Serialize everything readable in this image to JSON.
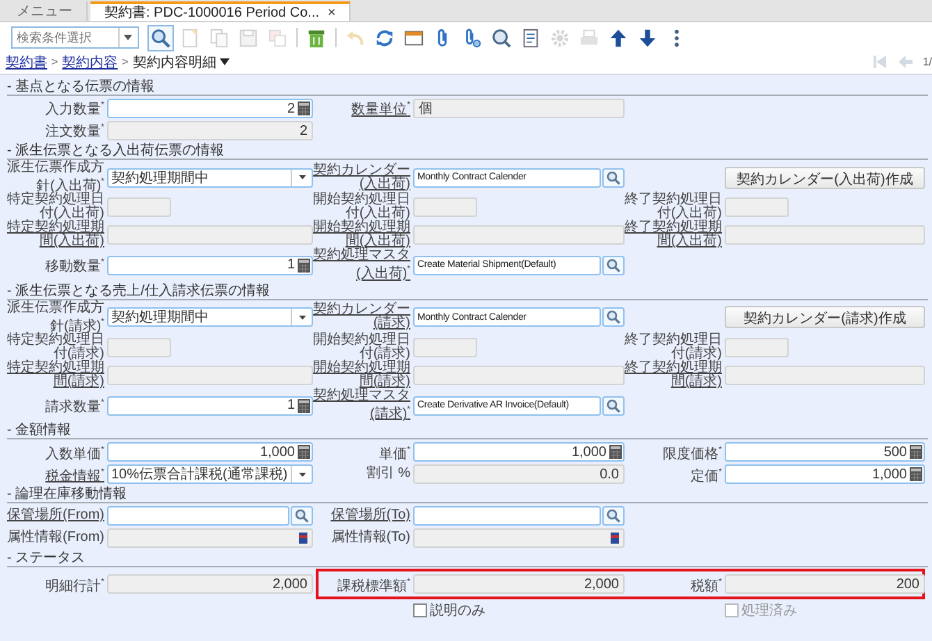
{
  "tabs": [
    {
      "label": "メニュー",
      "selected": false
    },
    {
      "label": "契約書: PDC-1000016 Period Co...",
      "selected": true,
      "close": "×"
    }
  ],
  "search": {
    "placeholder": "検索条件選択"
  },
  "toolbar": [
    {
      "kind": "search",
      "disabled": false
    },
    {
      "kind": "document",
      "disabled": true
    },
    {
      "kind": "copy",
      "disabled": true
    },
    {
      "kind": "save",
      "disabled": true
    },
    {
      "kind": "duplicate",
      "disabled": true
    },
    {
      "kind": "separator"
    },
    {
      "kind": "trash",
      "disabled": false
    },
    {
      "kind": "separator"
    },
    {
      "kind": "undo",
      "disabled": true
    },
    {
      "kind": "refresh",
      "disabled": false
    },
    {
      "kind": "window",
      "disabled": false
    },
    {
      "kind": "paperclip",
      "disabled": false
    },
    {
      "kind": "paperclip-search",
      "disabled": false
    },
    {
      "kind": "zoom",
      "disabled": false
    },
    {
      "kind": "report",
      "disabled": false
    },
    {
      "kind": "gear",
      "disabled": true
    },
    {
      "kind": "printer",
      "disabled": true
    },
    {
      "kind": "arrow-up",
      "disabled": false
    },
    {
      "kind": "arrow-down",
      "disabled": false
    },
    {
      "kind": "more",
      "disabled": false
    }
  ],
  "breadcrumb": {
    "separator": ">",
    "items": [
      {
        "label": "契約書",
        "link": true
      },
      {
        "label": "契約内容",
        "link": true
      },
      {
        "label": "契約内容明細",
        "link": false,
        "menu": true
      }
    ]
  },
  "record_nav": {
    "buttons": [
      {
        "kind": "first",
        "disabled": true
      },
      {
        "kind": "previous",
        "disabled": true
      }
    ],
    "position": "1/"
  },
  "sections": [
    {
      "title": "- 基点となる伝票の情報",
      "rows": [
        {
          "cells": [
            {
              "label": "入力数量$^{*}$",
              "link": false,
              "kind": "number",
              "value": "2"
            },
            {
              "label": "数量単位$^{*}$",
              "link": true,
              "kind": "text",
              "value": "個"
            },
            null
          ]
        },
        {
          "cells": [
            {
              "label": "注文数量$^{*}$",
              "link": false,
              "kind": "amount",
              "value": "2"
            },
            null,
            null
          ]
        }
      ]
    },
    {
      "title": "- 派生伝票となる入出荷伝票の情報",
      "rows": [
        {
          "cells": [
            {
              "label": "派生伝票作成方針(入出荷)$^{*}$",
              "link": false,
              "kind": "select",
              "value": "契約処理期間中"
            },
            {
              "label": "契約カレンダー(入出荷)",
              "link": true,
              "kind": "search",
              "value": "Monthly Contract Calender"
            },
            {
              "kind": "button",
              "value": "契約カレンダー(入出荷)作成"
            }
          ]
        },
        {
          "cells": [
            {
              "label": "特定契約処理日付(入出荷)",
              "link": false,
              "kind": "date"
            },
            {
              "label": "開始契約処理日付(入出荷)",
              "link": false,
              "kind": "date"
            },
            {
              "label": "終了契約処理日付(入出荷)",
              "link": false,
              "kind": "date"
            }
          ]
        },
        {
          "cells": [
            {
              "label": "特定契約処理期間(入出荷)",
              "link": true,
              "kind": "period"
            },
            {
              "label": "開始契約処理期間(入出荷)",
              "link": true,
              "kind": "period"
            },
            {
              "label": "終了契約処理期間(入出荷)",
              "link": true,
              "kind": "period"
            }
          ]
        },
        {
          "cells": [
            {
              "label": "移動数量$^{*}$",
              "link": false,
              "kind": "number",
              "value": "1"
            },
            {
              "label": "契約処理マスタ(入出荷)$^{*}$",
              "link": true,
              "kind": "search",
              "value": "Create Material Shipment(Default)"
            },
            null
          ]
        }
      ]
    },
    {
      "title": "- 派生伝票となる売上/仕入請求伝票の情報",
      "rows": [
        {
          "cells": [
            {
              "label": "派生伝票作成方針(請求)$^{*}$",
              "link": false,
              "kind": "select",
              "value": "契約処理期間中"
            },
            {
              "label": "契約カレンダー(請求)",
              "link": true,
              "kind": "search",
              "value": "Monthly Contract Calender"
            },
            {
              "kind": "button",
              "value": "契約カレンダー(請求)作成"
            }
          ]
        },
        {
          "cells": [
            {
              "label": "特定契約処理日付(請求)",
              "link": false,
              "kind": "date"
            },
            {
              "label": "開始契約処理日付(請求)",
              "link": false,
              "kind": "date"
            },
            {
              "label": "終了契約処理日付(請求)",
              "link": false,
              "kind": "date"
            }
          ]
        },
        {
          "cells": [
            {
              "label": "特定契約処理期間(請求)",
              "link": true,
              "kind": "period"
            },
            {
              "label": "開始契約処理期間(請求)",
              "link": true,
              "kind": "period"
            },
            {
              "label": "終了契約処理期間(請求)",
              "link": true,
              "kind": "period"
            }
          ]
        },
        {
          "cells": [
            {
              "label": "請求数量$^{*}$",
              "link": false,
              "kind": "number",
              "value": "1"
            },
            {
              "label": "契約処理マスタ(請求)$^{*}$",
              "link": true,
              "kind": "search",
              "value": "Create Derivative AR Invoice(Default)"
            },
            null
          ]
        }
      ]
    },
    {
      "title": "- 金額情報",
      "rows": [
        {
          "cells": [
            {
              "label": "入数単価$^{*}$",
              "link": false,
              "kind": "number",
              "value": "1,000"
            },
            {
              "label": "単価$^{*}$",
              "link": false,
              "kind": "number",
              "value": "1,000"
            },
            {
              "label": "限度価格$^{*}$",
              "link": false,
              "kind": "number",
              "value": "500"
            }
          ]
        },
        {
          "cells": [
            {
              "label": "税金情報$^{*}$",
              "link": true,
              "kind": "select",
              "value": "10%伝票合計課税(通常課税)"
            },
            {
              "label": "割引 %",
              "link": false,
              "kind": "amount",
              "value": "0.0"
            },
            {
              "label": "定価$^{*}$",
              "link": false,
              "kind": "number",
              "value": "1,000"
            }
          ]
        }
      ]
    },
    {
      "title": "- 論理在庫移動情報",
      "rows": [
        {
          "cells": [
            {
              "label": "保管場所(From)",
              "link": true,
              "kind": "search"
            },
            {
              "label": "保管場所(To)",
              "link": true,
              "kind": "search"
            },
            null
          ]
        },
        {
          "cells": [
            {
              "label": "属性情報(From)",
              "link": false,
              "kind": "attribute"
            },
            {
              "label": "属性情報(To)",
              "link": false,
              "kind": "attribute"
            },
            null
          ]
        }
      ]
    },
    {
      "title": "- ステータス",
      "rows": [
        {
          "cells": [
            {
              "label": "明細行計$^{*}$",
              "link": false,
              "kind": "amount",
              "value": "2,000"
            },
            {
              "label": "課税標準額$^{*}$",
              "link": false,
              "kind": "amount",
              "value": "2,000",
              "highlighted": true
            },
            {
              "label": "税額$^{*}$",
              "link": false,
              "kind": "amount",
              "value": "200",
              "highlighted": true
            }
          ]
        },
        {
          "cells": [
            null,
            {
              "kind": "checkbox",
              "value": "説明のみ",
              "checked": false,
              "disabled": false
            },
            {
              "kind": "checkbox",
              "value": "処理済み",
              "checked": false,
              "disabled": true
            }
          ]
        }
      ]
    }
  ]
}
